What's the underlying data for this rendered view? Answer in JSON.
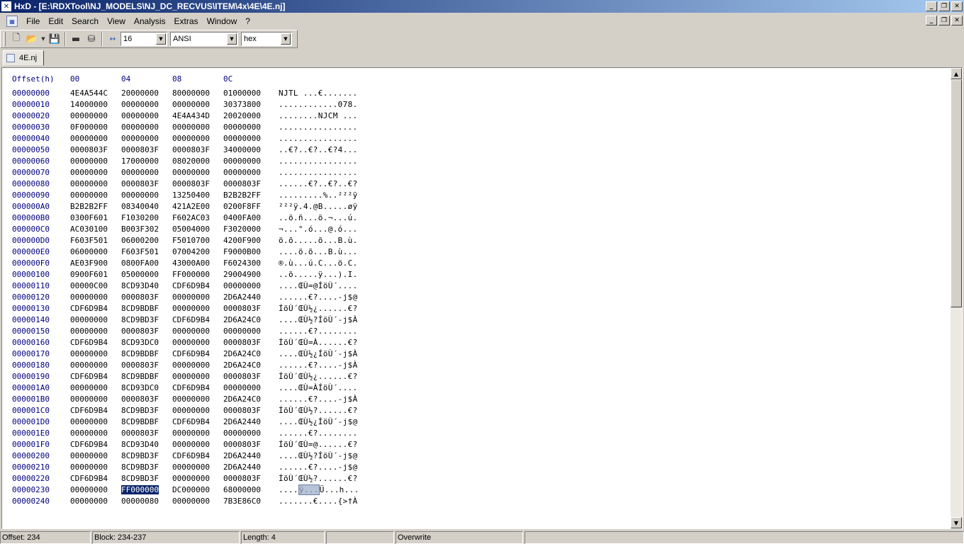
{
  "window": {
    "title": "HxD - [E:\\RDXTool\\NJ_MODELS\\NJ_DC_RECVUS\\ITEM\\4x\\4E\\4E.nj]",
    "app_icon": "hxd-logo-icon",
    "controls": {
      "minimize": "_",
      "restore": "❐",
      "close": "✕"
    }
  },
  "menubar": {
    "items": [
      "File",
      "Edit",
      "Search",
      "View",
      "Analysis",
      "Extras",
      "Window",
      "?"
    ]
  },
  "toolbar": {
    "icons": [
      "new-file-icon",
      "open-file-icon",
      "save-icon",
      "ram-icon",
      "disk-icon",
      "bytes-per-row-icon"
    ],
    "bytes_per_row": "16",
    "charset": "ANSI",
    "offset_base": "hex"
  },
  "tabs": [
    {
      "label": "4E.nj",
      "active": true
    }
  ],
  "hex_header": {
    "offset": "Offset(h)",
    "cols": [
      "00",
      "04",
      "08",
      "0C"
    ]
  },
  "rows": [
    {
      "o": "00000000",
      "h": [
        "4E4A544C",
        "20000000",
        "80000000",
        "01000000"
      ],
      "t": "NJTL ...€......."
    },
    {
      "o": "00000010",
      "h": [
        "14000000",
        "00000000",
        "00000000",
        "30373800"
      ],
      "t": "............078."
    },
    {
      "o": "00000020",
      "h": [
        "00000000",
        "00000000",
        "4E4A434D",
        "20020000"
      ],
      "t": "........NJCM ..."
    },
    {
      "o": "00000030",
      "h": [
        "0F000000",
        "00000000",
        "00000000",
        "00000000"
      ],
      "t": "................"
    },
    {
      "o": "00000040",
      "h": [
        "00000000",
        "00000000",
        "00000000",
        "00000000"
      ],
      "t": "................"
    },
    {
      "o": "00000050",
      "h": [
        "0000803F",
        "0000803F",
        "0000803F",
        "34000000"
      ],
      "t": "..€?..€?..€?4..."
    },
    {
      "o": "00000060",
      "h": [
        "00000000",
        "17000000",
        "08020000",
        "00000000"
      ],
      "t": "................"
    },
    {
      "o": "00000070",
      "h": [
        "00000000",
        "00000000",
        "00000000",
        "00000000"
      ],
      "t": "................"
    },
    {
      "o": "00000080",
      "h": [
        "00000000",
        "0000803F",
        "0000803F",
        "0000803F"
      ],
      "t": "......€?..€?..€?"
    },
    {
      "o": "00000090",
      "h": [
        "00000000",
        "00000000",
        "13250400",
        "B2B2B2FF"
      ],
      "t": ".........%..²²²ÿ"
    },
    {
      "o": "000000A0",
      "h": [
        "B2B2B2FF",
        "08340040",
        "421A2E00",
        "0200F8FF"
      ],
      "t": "²²²ÿ.4.@B.....øÿ"
    },
    {
      "o": "000000B0",
      "h": [
        "0300F601",
        "F1030200",
        "F602AC03",
        "0400FA00"
      ],
      "t": "..ö.ñ...ö.¬...ú."
    },
    {
      "o": "000000C0",
      "h": [
        "AC030100",
        "B003F302",
        "05004000",
        "F3020000"
      ],
      "t": "¬...°.ó...@.ó..."
    },
    {
      "o": "000000D0",
      "h": [
        "F603F501",
        "06000200",
        "F5010700",
        "4200F900"
      ],
      "t": "ö.õ.....õ...B.ù."
    },
    {
      "o": "000000E0",
      "h": [
        "06000000",
        "F603F501",
        "07004200",
        "F9000B00"
      ],
      "t": "....ö.õ...B.ù..."
    },
    {
      "o": "000000F0",
      "h": [
        "AE03F900",
        "0800FA00",
        "43000A00",
        "F6024300"
      ],
      "t": "®.ù...ú.C...ö.C."
    },
    {
      "o": "00000100",
      "h": [
        "0900F601",
        "05000000",
        "FF000000",
        "29004900"
      ],
      "t": "..ö.....ÿ...).I."
    },
    {
      "o": "00000110",
      "h": [
        "00000C00",
        "8CD93D40",
        "CDF6D9B4",
        "00000000"
      ],
      "t": "....ŒÙ=@ÍöÙ´...."
    },
    {
      "o": "00000120",
      "h": [
        "00000000",
        "0000803F",
        "00000000",
        "2D6A2440"
      ],
      "t": "......€?....-j$@"
    },
    {
      "o": "00000130",
      "h": [
        "CDF6D9B4",
        "8CD9BDBF",
        "00000000",
        "0000803F"
      ],
      "t": "ÍöÙ´ŒÙ½¿......€?"
    },
    {
      "o": "00000140",
      "h": [
        "00000000",
        "8CD9BD3F",
        "CDF6D9B4",
        "2D6A24C0"
      ],
      "t": "....ŒÙ½?ÍöÙ´-j$À"
    },
    {
      "o": "00000150",
      "h": [
        "00000000",
        "0000803F",
        "00000000",
        "00000000"
      ],
      "t": "......€?........"
    },
    {
      "o": "00000160",
      "h": [
        "CDF6D9B4",
        "8CD93DC0",
        "00000000",
        "0000803F"
      ],
      "t": "ÍöÙ´ŒÙ=À......€?"
    },
    {
      "o": "00000170",
      "h": [
        "00000000",
        "8CD9BDBF",
        "CDF6D9B4",
        "2D6A24C0"
      ],
      "t": "....ŒÙ½¿ÍöÙ´-j$À"
    },
    {
      "o": "00000180",
      "h": [
        "00000000",
        "0000803F",
        "00000000",
        "2D6A24C0"
      ],
      "t": "......€?....-j$À"
    },
    {
      "o": "00000190",
      "h": [
        "CDF6D9B4",
        "8CD9BDBF",
        "00000000",
        "0000803F"
      ],
      "t": "ÍöÙ´ŒÙ½¿......€?"
    },
    {
      "o": "000001A0",
      "h": [
        "00000000",
        "8CD93DC0",
        "CDF6D9B4",
        "00000000"
      ],
      "t": "....ŒÙ=ÀÍöÙ´...."
    },
    {
      "o": "000001B0",
      "h": [
        "00000000",
        "0000803F",
        "00000000",
        "2D6A24C0"
      ],
      "t": "......€?....-j$À"
    },
    {
      "o": "000001C0",
      "h": [
        "CDF6D9B4",
        "8CD9BD3F",
        "00000000",
        "0000803F"
      ],
      "t": "ÍöÙ´ŒÙ½?......€?"
    },
    {
      "o": "000001D0",
      "h": [
        "00000000",
        "8CD9BDBF",
        "CDF6D9B4",
        "2D6A2440"
      ],
      "t": "....ŒÙ½¿ÍöÙ´-j$@"
    },
    {
      "o": "000001E0",
      "h": [
        "00000000",
        "0000803F",
        "00000000",
        "00000000"
      ],
      "t": "......€?........"
    },
    {
      "o": "000001F0",
      "h": [
        "CDF6D9B4",
        "8CD93D40",
        "00000000",
        "0000803F"
      ],
      "t": "ÍöÙ´ŒÙ=@......€?"
    },
    {
      "o": "00000200",
      "h": [
        "00000000",
        "8CD9BD3F",
        "CDF6D9B4",
        "2D6A2440"
      ],
      "t": "....ŒÙ½?ÍöÙ´-j$@"
    },
    {
      "o": "00000210",
      "h": [
        "00000000",
        "8CD9BD3F",
        "00000000",
        "2D6A2440"
      ],
      "t": "......€?....-j$@"
    },
    {
      "o": "00000220",
      "h": [
        "CDF6D9B4",
        "8CD9BD3F",
        "00000000",
        "0000803F"
      ],
      "t": "ÍöÙ´ŒÙ½?......€?"
    },
    {
      "o": "00000230",
      "h": [
        "00000000",
        "FF000000",
        "DC000000",
        "68000000"
      ],
      "t": "....ÿ...Ü...h...",
      "sel_group": 1,
      "txt_pre": "....",
      "txt_sel": "ÿ...",
      "txt_post": "Ü...h..."
    },
    {
      "o": "00000240",
      "h": [
        "00000000",
        "00000080",
        "00000000",
        "7B3E86C0"
      ],
      "t": ".......€....{>†À"
    }
  ],
  "status": {
    "offset": "Offset: 234",
    "block": "Block: 234-237",
    "length": "Length: 4",
    "empty": "",
    "mode": "Overwrite"
  }
}
